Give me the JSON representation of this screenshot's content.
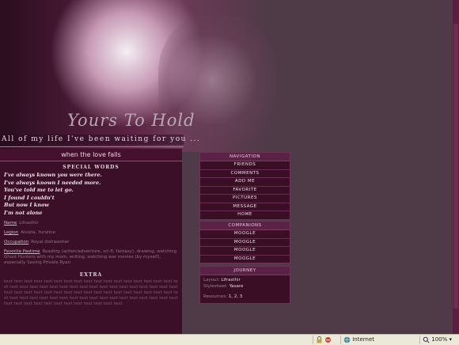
{
  "header": {
    "script_title": "Yours To Hold",
    "tagline": "All of my life I've been waiting for you ..."
  },
  "left": {
    "song_title": "when the love falls",
    "special_words_heading": "SPECIAL WORDS",
    "poem_lines": [
      "I've always known you were there.",
      "I've always known I needed more.",
      "You've told me to let go.",
      "I found I couldn't",
      "But now I know",
      "I'm not alone"
    ],
    "info": [
      {
        "label": "Name",
        "value": "Lifrasthir"
      },
      {
        "label": "Legion",
        "value": "Alvalia, Yuraline"
      },
      {
        "label": "Occupation",
        "value": "Royal dishwasher"
      },
      {
        "label": "Favorite Pastime",
        "value": "Reading (action/adventure, sci-fi, fantasy), drawing, watching Ghost Hunters with my mom, writing, watching war movies (by myself), especially Saving Private Ryan"
      }
    ],
    "extra_heading": "EXTRA",
    "filler_text": "text text text text text text text text text text text text text text text text text text text text text text text text text text text text text text text text text text text text text text text text text text text text text text text text text text text text text text text text text text text text text text text text text text text text text text text text text text text text text text text text text text"
  },
  "navigation": {
    "heading": "NAVIGATION",
    "items": [
      "FRIENDS",
      "COMMENTS",
      "ADD ME",
      "FAVORITE",
      "PICTURES",
      "MESSAGE",
      "HOME"
    ]
  },
  "companions": {
    "heading": "COMPANIONS",
    "items": [
      "MOOGLE",
      "MOOGLE",
      "MOOGLE",
      "MOOGLE"
    ]
  },
  "journey": {
    "heading": "JOURNEY",
    "layout_label": "Layout:",
    "layout_value": "Lifrasthir",
    "stylesheet_label": "Stylesheet:",
    "stylesheet_value": "Yasare",
    "resources_label": "Resources:",
    "resources_values": "1, 2, 3"
  },
  "statusbar": {
    "zone": "Internet",
    "zoom": "100%"
  },
  "colors": {
    "page_bg": "#4f3a47",
    "panel_bg": "#3c0f28",
    "accent": "#5a2245"
  }
}
